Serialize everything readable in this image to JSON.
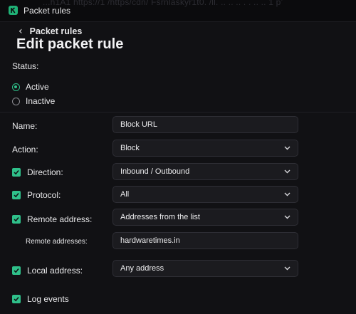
{
  "window": {
    "background_text": "...h1A1 https://1 /https/cdn/ Fsrnlaskyr1t0. /ll. .. ..  ..   .  . ..  ..  1 p’",
    "app_name": "Packet rules",
    "logo_icon": "kaspersky-k-icon",
    "accent_color": "#2fc08a"
  },
  "header": {
    "back_label": "Packet rules",
    "back_icon": "chevron-left-icon",
    "title": "Edit packet rule"
  },
  "status": {
    "label": "Status:",
    "options": [
      {
        "label": "Active",
        "selected": true
      },
      {
        "label": "Inactive",
        "selected": false
      }
    ]
  },
  "form": {
    "name": {
      "label": "Name:",
      "value": "Block URL"
    },
    "action": {
      "label": "Action:",
      "value": "Block"
    },
    "direction": {
      "label": "Direction:",
      "checked": true,
      "value": "Inbound / Outbound"
    },
    "protocol": {
      "label": "Protocol:",
      "checked": true,
      "value": "All"
    },
    "remote_address": {
      "label": "Remote address:",
      "checked": true,
      "value": "Addresses from the list"
    },
    "remote_addresses": {
      "label": "Remote addresses:",
      "value": "hardwaretimes.in"
    },
    "local_address": {
      "label": "Local address:",
      "checked": true,
      "value": "Any address"
    },
    "log_events": {
      "label": "Log events",
      "checked": true
    }
  }
}
